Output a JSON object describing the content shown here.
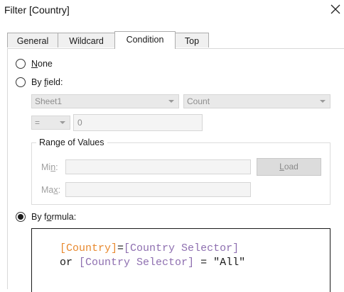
{
  "window": {
    "title": "Filter [Country]"
  },
  "tabs": [
    {
      "label": "General"
    },
    {
      "label": "Wildcard"
    },
    {
      "label": "Condition"
    },
    {
      "label": "Top"
    }
  ],
  "condition": {
    "none_label_first": "N",
    "none_label_rest": "one",
    "by_field_prefix": "By ",
    "by_field_u": "f",
    "by_field_rest": "ield:",
    "field_select": "Sheet1",
    "aggregation_select": "Count",
    "operator_select": "=",
    "value_input": "0",
    "range_legend": "Range of Values",
    "min_prefix": "Mi",
    "min_u": "n",
    "min_suffix": ":",
    "max_prefix": "Ma",
    "max_u": "x",
    "max_suffix": ":",
    "load_u": "L",
    "load_rest": "oad",
    "by_formula_prefix": "By f",
    "by_formula_u": "o",
    "by_formula_rest": "rmula:",
    "selected": "By formula"
  },
  "formula": {
    "line1": [
      {
        "text": "[Country]",
        "color": "#e8892f"
      },
      {
        "text": "=",
        "color": "#1a1a1a"
      },
      {
        "text": "[Country Selector]",
        "color": "#8e6fb0"
      }
    ],
    "line2": [
      {
        "text": "or ",
        "color": "#1a1a1a"
      },
      {
        "text": "[Country Selector]",
        "color": "#8e6fb0"
      },
      {
        "text": " = ",
        "color": "#1a1a1a"
      },
      {
        "text": "\"All\"",
        "color": "#1a1a1a"
      }
    ]
  }
}
